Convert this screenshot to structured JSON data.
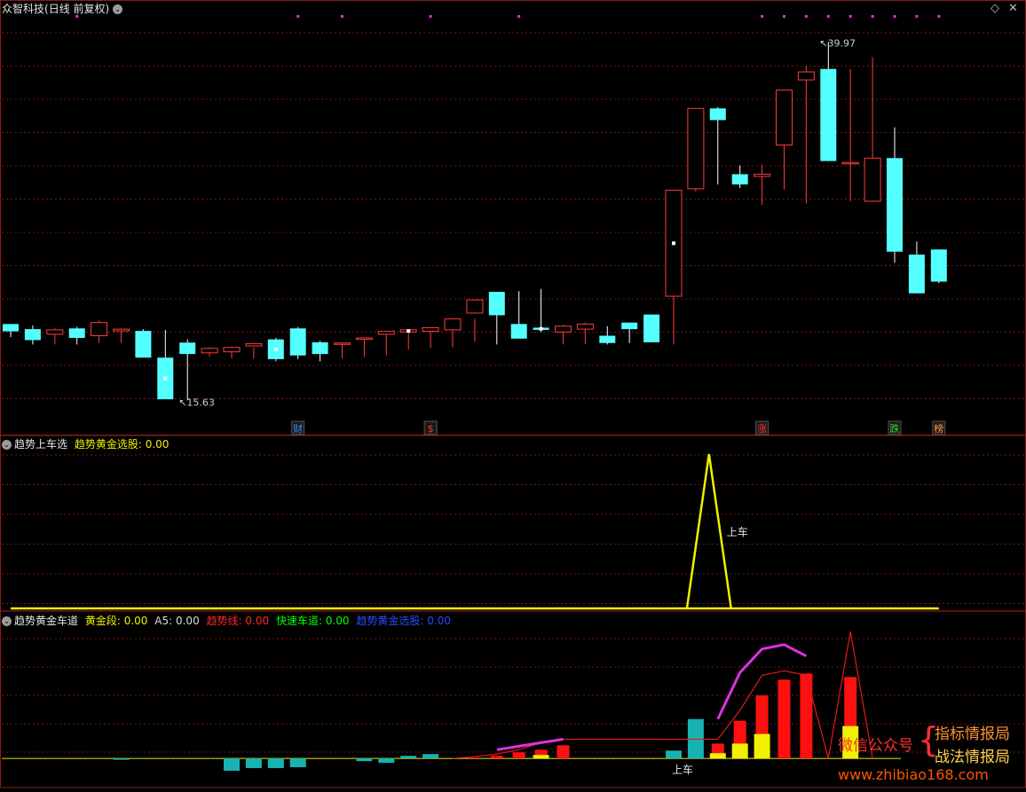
{
  "main_panel": {
    "title": "众智科技",
    "mode": "(日线 前复权)",
    "high_label": "39.97",
    "low_label": "15.63",
    "markers": [
      {
        "text": "财",
        "bar": 13,
        "color": "#3a8cff"
      },
      {
        "text": "$",
        "bar": 19,
        "color": "#ff3030"
      },
      {
        "text": "涨",
        "bar": 34,
        "color": "#ff3030"
      },
      {
        "text": "跌",
        "bar": 40,
        "color": "#35d835"
      },
      {
        "text": "榜",
        "bar": 42,
        "color": "#ff9a3a"
      }
    ]
  },
  "panel2": {
    "title": "趋势上车选",
    "label": "趋势黄金选股:",
    "value": "0.00",
    "annotation": "上车"
  },
  "panel3": {
    "title": "趋势黄金车道",
    "items": [
      {
        "label": "黄金段:",
        "value": "0.00",
        "color": "#f0f000"
      },
      {
        "label": "A5:",
        "value": "0.00",
        "color": "#dddddd"
      },
      {
        "label": "趋势线:",
        "value": "0.00",
        "color": "#ff2a2a"
      },
      {
        "label": "快速车道:",
        "value": "0.00",
        "color": "#00ff00"
      },
      {
        "label": "趋势黄金选股:",
        "value": "0.00",
        "color": "#2a4cff"
      }
    ],
    "annotation": "上车"
  },
  "watermark": {
    "left": "微信公众号",
    "brace": "{",
    "right_top": "指标情报局",
    "right_bottom": "战法情报局",
    "url": "www.zhibiao168.com"
  },
  "chart_data": [
    {
      "type": "candlestick",
      "title": "众智科技 (日线 前复权)",
      "x": [
        0,
        1,
        2,
        3,
        4,
        5,
        6,
        7,
        8,
        9,
        10,
        11,
        12,
        13,
        14,
        15,
        16,
        17,
        18,
        19,
        20,
        21,
        22,
        23,
        24,
        25,
        26,
        27,
        28,
        29,
        30,
        31,
        32,
        33,
        34,
        35,
        36,
        37,
        38,
        39,
        40,
        41,
        42
      ],
      "open": [
        20.85,
        20.5,
        20.15,
        20.55,
        20.05,
        20.38,
        20.38,
        18.55,
        19.58,
        18.88,
        18.95,
        19.35,
        19.8,
        20.55,
        19.6,
        19.55,
        19.8,
        20.15,
        20.3,
        20.35,
        20.45,
        21.6,
        23.05,
        20.85,
        20.6,
        20.3,
        20.5,
        20.05,
        20.95,
        21.5,
        22.75,
        30.1,
        35.6,
        31.1,
        30.95,
        33.1,
        37.55,
        38.3,
        31.9,
        29.25,
        32.2,
        25.6,
        25.95
      ],
      "high": [
        20.85,
        20.75,
        20.55,
        20.65,
        21.1,
        20.55,
        20.5,
        20.45,
        19.8,
        19.28,
        19.3,
        19.25,
        19.9,
        20.65,
        19.7,
        19.6,
        19.9,
        20.25,
        20.35,
        20.45,
        20.7,
        21.2,
        22.1,
        23.1,
        23.25,
        20.8,
        20.95,
        20.7,
        20.7,
        21.15,
        22.8,
        30.2,
        35.7,
        31.7,
        31.75,
        36.15,
        38.5,
        40.15,
        38.3,
        39.1,
        34.3,
        26.5,
        25.95
      ],
      "low": [
        19.95,
        19.45,
        19.45,
        19.45,
        19.55,
        19.55,
        18.55,
        16.3,
        15.63,
        18.6,
        18.5,
        18.5,
        18.3,
        18.45,
        18.3,
        18.5,
        18.6,
        18.7,
        19.1,
        19.2,
        19.25,
        19.65,
        19.45,
        20.25,
        20.3,
        19.45,
        19.5,
        19.45,
        19.55,
        19.65,
        19.45,
        29.9,
        30.4,
        30.15,
        29.0,
        30.05,
        29.1,
        32.0,
        29.25,
        29.2,
        25.05,
        23.4,
        23.65
      ],
      "close": [
        20.35,
        19.75,
        20.45,
        19.9,
        20.95,
        20.5,
        18.55,
        15.7,
        18.8,
        19.18,
        19.25,
        19.5,
        18.45,
        18.7,
        18.8,
        19.55,
        19.9,
        20.35,
        20.45,
        20.6,
        21.2,
        22.5,
        21.45,
        19.85,
        20.45,
        20.7,
        20.85,
        19.55,
        20.5,
        19.6,
        30.0,
        35.6,
        34.8,
        30.4,
        31.1,
        36.85,
        38.1,
        32.0,
        31.9,
        32.2,
        25.8,
        22.95,
        23.75
      ],
      "ylim": [
        14.5,
        41.5
      ]
    },
    {
      "type": "line",
      "title": "趋势上车选",
      "series": [
        {
          "name": "趋势黄金选股",
          "values": [
            0,
            0,
            0,
            0,
            0,
            0,
            0,
            0,
            0,
            0,
            0,
            0,
            0,
            0,
            0,
            0,
            0,
            0,
            0,
            0,
            0,
            0,
            0,
            0,
            0,
            0,
            0,
            0,
            0,
            0,
            0,
            0,
            0,
            0,
            0,
            0,
            0,
            0,
            0,
            0,
            0,
            0,
            0
          ]
        }
      ],
      "spike": {
        "x": [
          30.6,
          31.6,
          32.6
        ],
        "values": [
          0,
          100,
          0
        ]
      },
      "ylim": [
        0,
        100
      ]
    },
    {
      "type": "bar",
      "title": "趋势黄金车道",
      "x": [
        0,
        1,
        2,
        3,
        4,
        5,
        6,
        7,
        8,
        9,
        10,
        11,
        12,
        13,
        14,
        15,
        16,
        17,
        18,
        19,
        20,
        21,
        22,
        23,
        24,
        25,
        26,
        27,
        28,
        29,
        30,
        31,
        32,
        33,
        34,
        35,
        36,
        37,
        38,
        39,
        40,
        41,
        42
      ],
      "cyan_bars": [
        0,
        0,
        0,
        0,
        0,
        -1,
        0,
        0,
        0,
        0,
        -14,
        -11,
        -11,
        -10,
        0,
        0,
        -3,
        -5,
        3,
        5,
        0,
        0,
        0,
        0,
        0,
        0,
        0,
        0,
        0,
        0,
        9,
        45,
        0,
        0,
        0,
        0,
        0,
        0,
        0,
        0,
        0,
        0,
        0
      ],
      "red_bars": [
        0,
        0,
        0,
        0,
        0,
        0,
        0,
        0,
        0,
        0,
        0,
        0,
        0,
        0,
        0,
        0,
        0,
        0,
        0,
        0,
        0,
        1,
        3,
        7,
        10,
        15,
        0,
        0,
        0,
        0,
        0,
        0,
        17,
        43,
        72,
        90,
        97,
        0,
        93,
        0,
        0,
        0,
        0
      ],
      "yellow_bars": [
        0,
        0,
        0,
        0,
        0,
        0,
        0,
        0,
        0,
        0,
        0,
        0,
        0,
        0,
        0,
        0,
        0,
        0,
        0,
        0,
        0,
        0,
        0,
        0,
        4,
        0,
        0,
        0,
        0,
        0,
        0,
        0,
        6,
        17,
        28,
        0,
        0,
        0,
        37,
        0,
        0,
        0,
        0
      ],
      "trend_line": {
        "x": [
          20,
          21,
          22,
          23,
          24,
          25,
          32,
          33,
          34,
          35,
          36,
          37,
          38,
          39
        ],
        "values": [
          0,
          2,
          5,
          10,
          18,
          22,
          22,
          55,
          95,
          100,
          95,
          0,
          145,
          0
        ]
      },
      "fast_lane": {
        "x": [
          22,
          23,
          24,
          25,
          32,
          33,
          34,
          35,
          36,
          37
        ],
        "values": [
          10,
          14,
          18,
          22,
          45,
          98,
          125,
          130,
          117,
          0
        ]
      },
      "ylim": [
        -15,
        145
      ]
    }
  ]
}
